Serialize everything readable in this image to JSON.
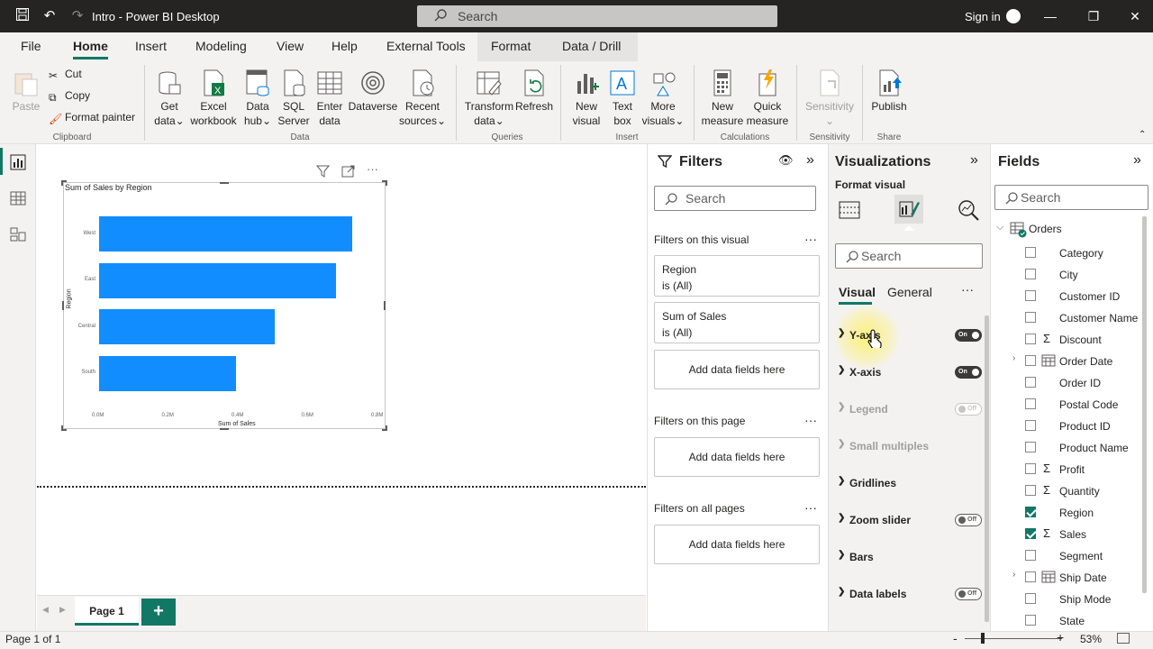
{
  "titlebar": {
    "title": "Intro - Power BI Desktop",
    "search_placeholder": "Search",
    "signin": "Sign in"
  },
  "menu": {
    "tabs": [
      "File",
      "Home",
      "Insert",
      "Modeling",
      "View",
      "Help",
      "External Tools",
      "Format",
      "Data / Drill"
    ],
    "active": "Home"
  },
  "ribbon": {
    "clipboard": {
      "paste": "Paste",
      "cut": "Cut",
      "copy": "Copy",
      "format_painter": "Format painter",
      "group": "Clipboard"
    },
    "data": {
      "get_data_1": "Get",
      "get_data_2": "data",
      "excel_1": "Excel",
      "excel_2": "workbook",
      "hub_1": "Data",
      "hub_2": "hub",
      "sql_1": "SQL",
      "sql_2": "Server",
      "enter_1": "Enter",
      "enter_2": "data",
      "dataverse": "Dataverse",
      "recent_1": "Recent",
      "recent_2": "sources",
      "group": "Data"
    },
    "queries": {
      "transform_1": "Transform",
      "transform_2": "data",
      "refresh": "Refresh",
      "group": "Queries"
    },
    "insert": {
      "new_visual_1": "New",
      "new_visual_2": "visual",
      "text_box_1": "Text",
      "text_box_2": "box",
      "more_1": "More",
      "more_2": "visuals",
      "group": "Insert"
    },
    "calculations": {
      "new_measure_1": "New",
      "new_measure_2": "measure",
      "quick_1": "Quick",
      "quick_2": "measure",
      "group": "Calculations"
    },
    "sensitivity": {
      "label": "Sensitivity",
      "group": "Sensitivity"
    },
    "share": {
      "publish": "Publish",
      "group": "Share"
    }
  },
  "visual": {
    "title": "Sum of Sales by Region",
    "chart_data": {
      "type": "bar",
      "orientation": "horizontal",
      "title": "Sum of Sales by Region",
      "categories": [
        "West",
        "East",
        "Central",
        "South"
      ],
      "values": [
        0.725,
        0.678,
        0.502,
        0.392
      ],
      "xlabel": "Sum of Sales",
      "ylabel": "Region",
      "x_ticks": [
        "0.0M",
        "0.2M",
        "0.4M",
        "0.6M",
        "0.8M"
      ],
      "xlim": [
        0,
        0.8
      ],
      "color": "#118dff"
    }
  },
  "pages": {
    "tab": "Page 1",
    "add": "+",
    "count": "Page 1 of 1"
  },
  "zoom": {
    "minus": "-",
    "plus": "+",
    "value": "53%"
  },
  "filters": {
    "title": "Filters",
    "search": "Search",
    "on_visual": "Filters on this visual",
    "cards": [
      {
        "name": "Region",
        "state": "is (All)"
      },
      {
        "name": "Sum of Sales",
        "state": "is (All)"
      }
    ],
    "add_here": "Add data fields here",
    "on_page": "Filters on this page",
    "on_all": "Filters on all pages",
    "more": "···"
  },
  "visualizations": {
    "title": "Visualizations",
    "subtitle": "Format visual",
    "search": "Search",
    "tabs": [
      "Visual",
      "General"
    ],
    "more": "···",
    "sections": [
      {
        "label": "Y-axis",
        "toggle": "On"
      },
      {
        "label": "X-axis",
        "toggle": "On"
      },
      {
        "label": "Legend",
        "toggle": "Off"
      },
      {
        "label": "Small multiples",
        "toggle": ""
      },
      {
        "label": "Gridlines",
        "toggle": ""
      },
      {
        "label": "Zoom slider",
        "toggle": "Off"
      },
      {
        "label": "Bars",
        "toggle": ""
      },
      {
        "label": "Data labels",
        "toggle": "Off"
      }
    ]
  },
  "fields": {
    "title": "Fields",
    "search": "Search",
    "table": "Orders",
    "items": [
      {
        "label": "Category",
        "checked": false,
        "sigma": false
      },
      {
        "label": "City",
        "checked": false,
        "sigma": false
      },
      {
        "label": "Customer ID",
        "checked": false,
        "sigma": false
      },
      {
        "label": "Customer Name",
        "checked": false,
        "sigma": false
      },
      {
        "label": "Discount",
        "checked": false,
        "sigma": true
      },
      {
        "label": "Order Date",
        "checked": false,
        "sigma": false
      },
      {
        "label": "Order ID",
        "checked": false,
        "sigma": false
      },
      {
        "label": "Postal Code",
        "checked": false,
        "sigma": false
      },
      {
        "label": "Product ID",
        "checked": false,
        "sigma": false
      },
      {
        "label": "Product Name",
        "checked": false,
        "sigma": false
      },
      {
        "label": "Profit",
        "checked": false,
        "sigma": true
      },
      {
        "label": "Quantity",
        "checked": false,
        "sigma": true
      },
      {
        "label": "Region",
        "checked": true,
        "sigma": false
      },
      {
        "label": "Sales",
        "checked": true,
        "sigma": true
      },
      {
        "label": "Segment",
        "checked": false,
        "sigma": false
      },
      {
        "label": "Ship Date",
        "checked": false,
        "sigma": false
      },
      {
        "label": "Ship Mode",
        "checked": false,
        "sigma": false
      },
      {
        "label": "State",
        "checked": false,
        "sigma": false
      }
    ]
  }
}
